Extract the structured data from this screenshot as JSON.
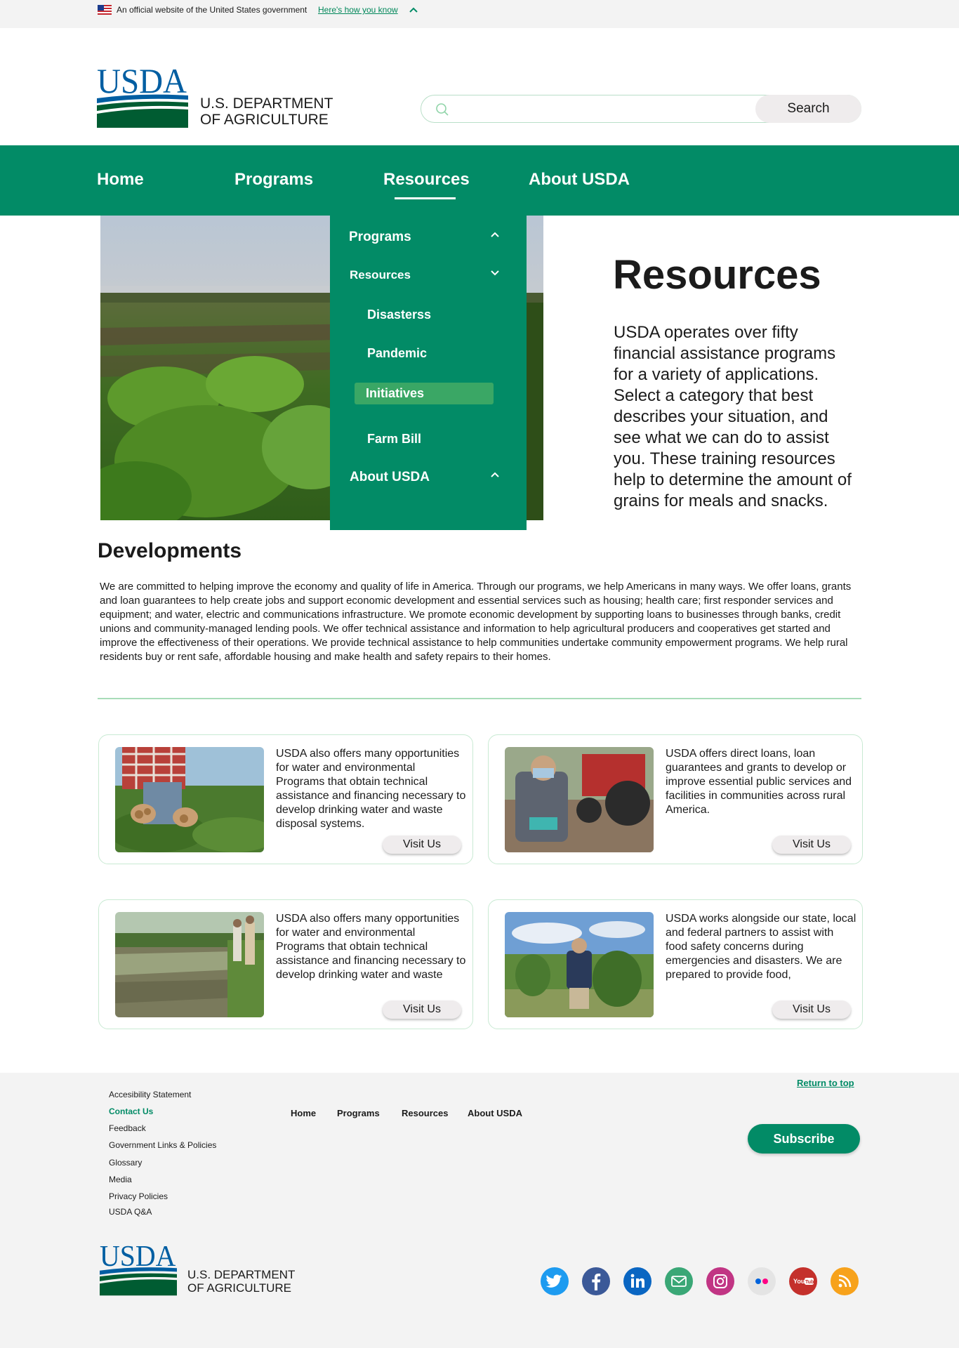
{
  "gov_banner": {
    "text": "An official website of the United States government",
    "link": "Here's how you know"
  },
  "header": {
    "logo_text": "USDA",
    "dept_line1": "U.S. DEPARTMENT",
    "dept_line2": "OF AGRICULTURE",
    "search": {
      "placeholder": "",
      "value": "",
      "button": "Search"
    }
  },
  "nav": {
    "items": [
      "Home",
      "Programs",
      "Resources",
      "About USDA"
    ],
    "active": "Resources"
  },
  "dropdown": {
    "programs": "Programs",
    "resources": "Resources",
    "sub": [
      "Disasterss",
      "Pandemic",
      "Initiatives",
      "Farm Bill"
    ],
    "about": "About USDA"
  },
  "hero": {
    "title": "Resources",
    "text": "USDA operates over fifty financial assistance programs for a variety of applications. Select a category that best describes your situation, and see what we can do to assist you. These training resources help to determine the amount of grains for meals and snacks."
  },
  "developments": {
    "title": "Developments",
    "text": "We are committed to helping improve the economy and quality of life in America. Through our programs, we help Americans in many ways. We offer loans, grants and loan guarantees to help create jobs and support economic development and essential services such as housing; health care; first responder services and equipment; and water, electric and communications infrastructure. We promote economic development by supporting loans to businesses through banks, credit unions and community-managed lending pools. We offer technical assistance and information to help agricultural producers and cooperatives get started and improve the effectiveness of their operations. We provide technical assistance to help communities undertake community empowerment programs. We help rural residents buy or rent safe, affordable housing and make health and safety repairs to their homes."
  },
  "cards": [
    {
      "text": "USDA also offers many opportunities for water and environmental Programs that obtain technical assistance and financing necessary to develop drinking water and waste disposal systems.",
      "button": "Visit Us"
    },
    {
      "text": "USDA offers direct loans, loan guarantees and grants to develop or improve essential public services and facilities in communities across rural America.",
      "button": "Visit Us"
    },
    {
      "text": "USDA also offers many opportunities for water and environmental Programs that obtain technical assistance and financing necessary to develop drinking water and waste",
      "button": "Visit Us"
    },
    {
      "text": "USDA works alongside our state, local and federal partners to assist with food safety concerns during emergencies and disasters. We are prepared to provide food,",
      "button": "Visit Us"
    }
  ],
  "footer": {
    "links": [
      "Accesibility Statement",
      "Contact Us",
      "Feedback",
      "Government Links & Policies",
      "Glossary",
      "Media",
      "Privacy Policies",
      "USDA Q&A"
    ],
    "nav": [
      "Home",
      "Programs",
      "Resources",
      "About USDA"
    ],
    "return_top": "Return to top",
    "subscribe": "Subscribe",
    "logo_text": "USDA",
    "dept_line1": "U.S. DEPARTMENT",
    "dept_line2": "OF AGRICULTURE",
    "social": [
      "twitter-icon",
      "facebook-icon",
      "linkedin-icon",
      "email-icon",
      "instagram-icon",
      "flickr-icon",
      "youtube-icon",
      "rss-icon"
    ]
  },
  "colors": {
    "brand_green": "#028b66",
    "usda_blue": "#005ea2",
    "active_green": "#3aa765"
  }
}
